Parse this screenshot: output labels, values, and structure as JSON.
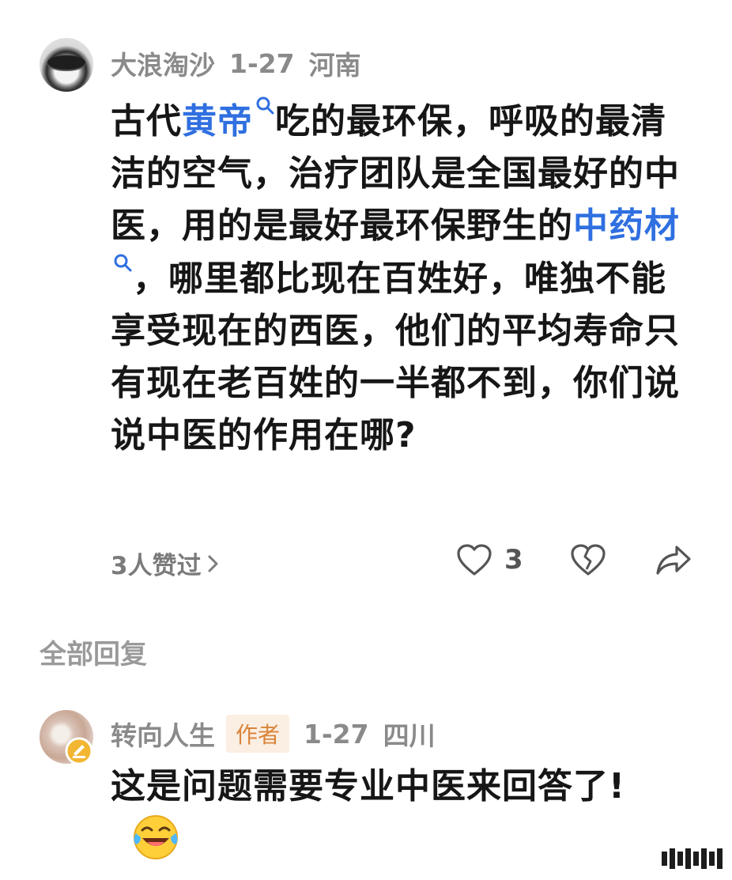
{
  "comment": {
    "username": "大浪淘沙",
    "date": "1-27",
    "location": "河南",
    "text_before_link1": "古代",
    "link1": "黄帝",
    "text_between": "吃的最环保，呼吸的最清洁的空气，治疗团队是全国最好的中医，用的是最好最环保野生的",
    "link2": "中药材",
    "text_after": "，哪里都比现在百姓好，唯独不能享受现在的西医，他们的平均寿命只有现在老百姓的一半都不到，你们说说中医的作用在哪?",
    "likers_label": "3人赞过",
    "like_count": "3",
    "icons": [
      "avatar-bowl",
      "search-icon",
      "heart-icon",
      "broken-heart-icon",
      "share-icon",
      "chevron-right-icon"
    ]
  },
  "replies_section_title": "全部回复",
  "reply": {
    "username": "转向人生",
    "author_badge": "作者",
    "date": "1-27",
    "location": "四川",
    "text": "这是问题需要专业中医来回答了!",
    "emoji": "laughing-crying-emoji"
  },
  "colors": {
    "link": "#2f6fe0",
    "meta": "#8a8a8a",
    "author_badge_bg": "#fbeee2",
    "author_badge_text": "#d9843a",
    "badge_gold": "#f2b632"
  }
}
